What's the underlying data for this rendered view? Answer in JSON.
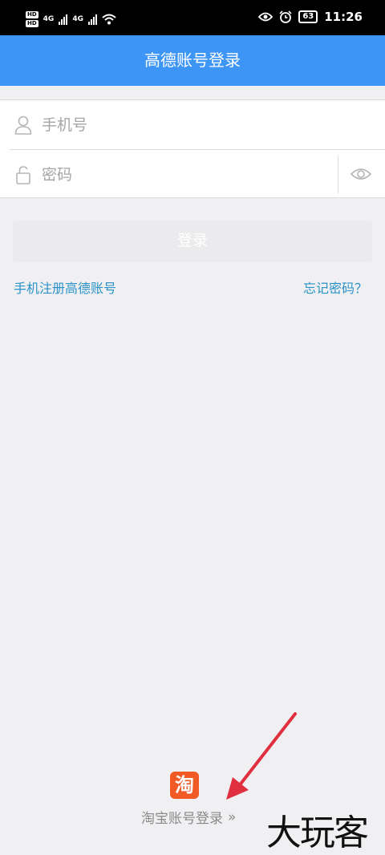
{
  "status_bar": {
    "hd1": "HD",
    "hd2": "HD",
    "net1": "4G",
    "net2": "4G",
    "battery": "63",
    "time": "11:26"
  },
  "header": {
    "title": "高德账号登录"
  },
  "form": {
    "phone_placeholder": "手机号",
    "password_placeholder": "密码",
    "login_label": "登录"
  },
  "links": {
    "register": "手机注册高德账号",
    "forgot": "忘记密码？"
  },
  "taobao": {
    "logo_char": "淘",
    "label": "淘宝账号登录",
    "chevron": "»"
  },
  "watermark": "大玩客",
  "colors": {
    "header_bg": "#3d95f5",
    "link": "#2a92c8",
    "taobao_orange": "#f15a24",
    "annotation_arrow": "#e03040"
  }
}
